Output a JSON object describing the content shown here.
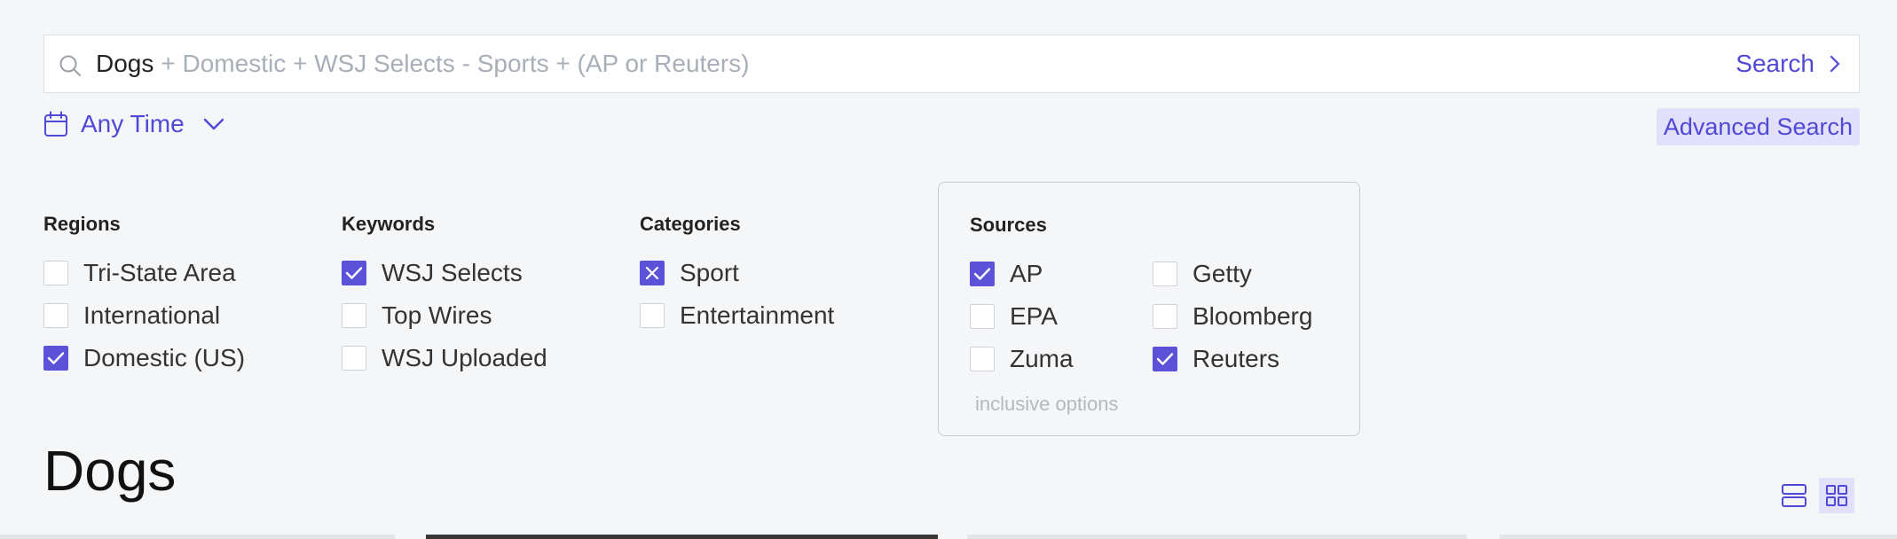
{
  "search": {
    "term": "Dogs",
    "hint": "+ Domestic + WSJ Selects - Sports + (AP or Reuters)",
    "button_label": "Search"
  },
  "time_filter": {
    "label": "Any Time"
  },
  "advanced_search": {
    "label": "Advanced Search"
  },
  "filters": {
    "regions": {
      "title": "Regions",
      "options": [
        {
          "label": "Tri-State Area",
          "state": "unchecked"
        },
        {
          "label": "International",
          "state": "unchecked"
        },
        {
          "label": "Domestic (US)",
          "state": "checked"
        }
      ]
    },
    "keywords": {
      "title": "Keywords",
      "options": [
        {
          "label": "WSJ Selects",
          "state": "checked"
        },
        {
          "label": "Top Wires",
          "state": "unchecked"
        },
        {
          "label": "WSJ Uploaded",
          "state": "unchecked"
        }
      ]
    },
    "categories": {
      "title": "Categories",
      "options": [
        {
          "label": "Sport",
          "state": "excluded"
        },
        {
          "label": "Entertainment",
          "state": "unchecked"
        }
      ]
    },
    "sources": {
      "title": "Sources",
      "options": [
        {
          "label": "AP",
          "state": "checked"
        },
        {
          "label": "Getty",
          "state": "unchecked"
        },
        {
          "label": "EPA",
          "state": "unchecked"
        },
        {
          "label": "Bloomberg",
          "state": "unchecked"
        },
        {
          "label": "Zuma",
          "state": "unchecked"
        },
        {
          "label": "Reuters",
          "state": "checked"
        }
      ],
      "note": "inclusive options"
    }
  },
  "results": {
    "title": "Dogs",
    "view_modes": [
      {
        "icon": "list-view-icon",
        "active": false
      },
      {
        "icon": "grid-view-icon",
        "active": true
      }
    ]
  },
  "colors": {
    "accent": "#5048d6",
    "checkbox_fill": "#5b52d8",
    "active_bg": "#e2e0fa",
    "page_bg": "#f5f6f8"
  }
}
